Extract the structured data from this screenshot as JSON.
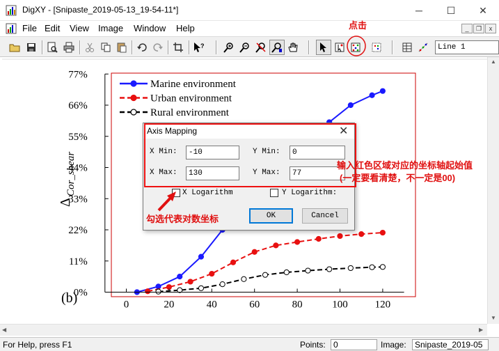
{
  "window": {
    "title": "DigXY - [Snipaste_2019-05-13_19-54-11*]",
    "minimize_glyph": "─",
    "maximize_glyph": "☐",
    "close_glyph": "✕"
  },
  "menu": {
    "items": [
      "File",
      "Edit",
      "View",
      "Image",
      "Window",
      "Help"
    ],
    "mdi_minimize": "_",
    "mdi_restore": "❐",
    "mdi_close": "x"
  },
  "toolbar": {
    "buttons": [
      "open-icon",
      "save-icon",
      "print-preview-icon",
      "print-icon",
      "cut-icon",
      "copy-icon",
      "paste-icon",
      "undo-icon",
      "redo-icon",
      "crop-icon",
      "help-pointer-icon",
      "zoom-in-icon",
      "zoom-out-icon",
      "zoom-reset-icon",
      "zoom-fit-icon",
      "pan-hand-icon",
      "select-arrow-icon",
      "point-digitize-icon",
      "axis-mapping-icon",
      "grid-points-icon",
      "table-icon",
      "auto-trace-icon"
    ],
    "line_select": "Line 1"
  },
  "chart_data": {
    "type": "line",
    "ylabel": "Δ",
    "ylabel_subscript": "Cor_shear",
    "panel_label": "(b)",
    "x_ticks": [
      "0",
      "20",
      "40",
      "60",
      "80",
      "100",
      "120"
    ],
    "y_ticks": [
      "0%",
      "11%",
      "22%",
      "33%",
      "44%",
      "55%",
      "66%",
      "77%"
    ],
    "xlim": [
      -10,
      130
    ],
    "ylim": [
      0,
      77
    ],
    "series": [
      {
        "name": "Marine environment",
        "color": "#1a1aff",
        "line_style": "solid",
        "marker": "filled-circle",
        "x": [
          5,
          15,
          25,
          35,
          45,
          55,
          65,
          75,
          85,
          95,
          105,
          115,
          120
        ],
        "y": [
          0,
          2,
          5.5,
          12.5,
          22,
          31,
          40,
          48,
          55,
          60,
          66,
          69.5,
          71
        ]
      },
      {
        "name": "Urban   environment",
        "color": "#e81010",
        "line_style": "dashed",
        "marker": "filled-circle",
        "x": [
          10,
          20,
          30,
          40,
          50,
          60,
          70,
          80,
          90,
          100,
          110,
          120
        ],
        "y": [
          0.3,
          1.8,
          3.7,
          6.5,
          10.5,
          14.2,
          16.5,
          17.7,
          18.8,
          19.8,
          20.5,
          21
        ]
      },
      {
        "name": "Rural    environment",
        "color": "#000000",
        "line_style": "dashed",
        "marker": "open-circle",
        "x": [
          15,
          25,
          35,
          45,
          55,
          65,
          75,
          85,
          95,
          105,
          115,
          120
        ],
        "y": [
          0.2,
          0.7,
          1.4,
          2.8,
          4.6,
          6.1,
          7.0,
          7.6,
          8.1,
          8.5,
          8.8,
          8.9
        ]
      }
    ]
  },
  "dialog": {
    "title": "Axis Mapping",
    "close_glyph": "✕",
    "x_min_label": "X Min:",
    "x_min_value": "-10",
    "x_max_label": "X Max:",
    "x_max_value": "130",
    "y_min_label": "Y Min:",
    "y_min_value": "0",
    "y_max_label": "Y Max:",
    "y_max_value": "77",
    "x_log_label": "X Logarithm",
    "y_log_label": "Y Logarithm:",
    "x_log_checked": false,
    "y_log_checked": false,
    "ok_label": "OK",
    "cancel_label": "Cancel"
  },
  "annotations": {
    "click_hint": "点击",
    "range_hint_line1": "输入红色区域对应的坐标轴起始值",
    "range_hint_line2": "(一定要看清楚，不一定是00)",
    "log_hint": "勾选代表对数坐标",
    "color": "#e01010"
  },
  "status": {
    "help_text": "For Help, press F1",
    "points_label": "Points:",
    "points_value": "0",
    "image_label": "Image:",
    "image_value": "Snipaste_2019-05"
  }
}
